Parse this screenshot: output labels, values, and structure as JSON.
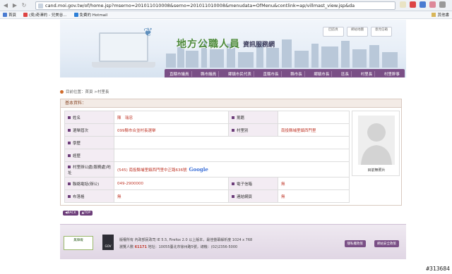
{
  "browser": {
    "url": "cand.moi.gov.tw/of/home.jsp?mserno=201011010008&serno=201011010008&menudata=OfMenu&contlink=ap/villmast_view.jsp&da",
    "bookmarks": [
      "首頁",
      "(吳)奇澤的 - 兒美谷...",
      "免費的 Hotmail"
    ],
    "other_bookmarks": "其他書"
  },
  "site": {
    "logo_main": "地方公職人員",
    "logo_sub": "資訊服務網",
    "top_links": [
      "回首頁",
      "網站地圖",
      "意見信箱"
    ],
    "menu": [
      "直轄市議員",
      "縣市議員",
      "鄉鎮市民代表",
      "直轄市長",
      "縣市長",
      "鄉鎮市長",
      "區長",
      "村里長",
      "村里幹事"
    ],
    "breadcrumb": "目前位置：首頁 >村里長"
  },
  "profile": {
    "section_title": "基本資料：",
    "rows": [
      {
        "label": "姓名",
        "value": "陳　瑞忠",
        "label2": "黨籍",
        "value2": ""
      },
      {
        "label": "選舉屆次",
        "value": "099縣市合並村長選舉",
        "label2": "村里別",
        "value2": "南投縣埔里鎮西門里"
      },
      {
        "label": "學歷",
        "value": ""
      },
      {
        "label": "經歷",
        "value": ""
      },
      {
        "label": "村里辦公處(服務處)地址",
        "value": "(545) 南投縣埔里鎮西門里中正路636號"
      },
      {
        "label": "聯絡電話(辦公)",
        "value": "049-2900000",
        "label2": "電子信箱",
        "value2": "無"
      },
      {
        "label": "布落格",
        "value": "無",
        "label2": "連結網頁",
        "value2": "無"
      }
    ],
    "photo_label": "目前無照片",
    "google_label": "Google",
    "back_button": "BACK",
    "top_button": "TOP"
  },
  "footer": {
    "logo1": "無障礙",
    "logo2": "GOV",
    "line1": "版權所有 內政部民政司 IE 5.5, Firefox 2.0 以上版本，最佳螢幕解析度 1024 x 768",
    "line2_prefix": "瀏覽人數",
    "visitor_count": "61171",
    "line2_suffix": "地址：10055臺北市徐州路5號，總機：(02)2356-5000",
    "buttons": [
      "隱私權政策",
      "網站安全政策"
    ]
  },
  "stamp": "#313684"
}
